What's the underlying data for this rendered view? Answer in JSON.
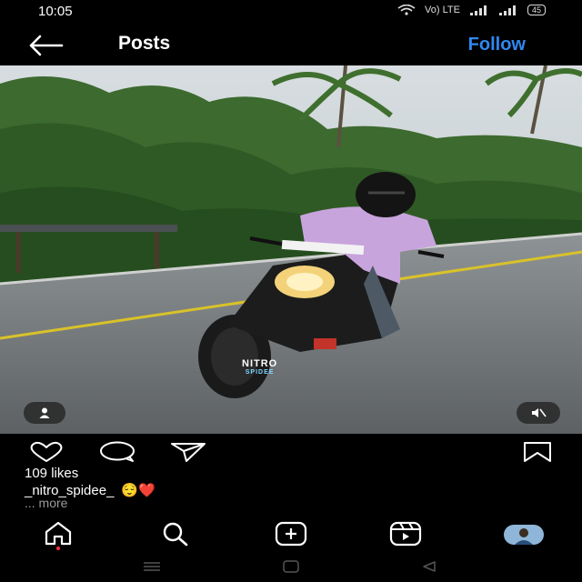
{
  "status": {
    "time": "10:05",
    "network": "Vo) LTE",
    "battery": "45"
  },
  "header": {
    "title": "Posts",
    "follow_label": "Follow"
  },
  "post": {
    "watermark_line1": "NITRO",
    "watermark_line2": "SPIDEE",
    "likes": "109 likes",
    "username": "_nitro_spidee_",
    "caption_emojis": "😌❤️",
    "more_label": "... more"
  },
  "icons": {
    "back": "arrow-left-icon",
    "like": "heart-icon",
    "comment": "comment-icon",
    "share": "send-icon",
    "save": "bookmark-icon",
    "tagged": "person-icon",
    "mute": "speaker-muted-icon",
    "home": "home-icon",
    "search": "search-icon",
    "new_post": "plus-square-icon",
    "reels": "reels-icon",
    "profile": "profile-avatar"
  },
  "colors": {
    "accent": "#2f88f1",
    "background": "#000000",
    "notification_dot": "#ff3040"
  }
}
